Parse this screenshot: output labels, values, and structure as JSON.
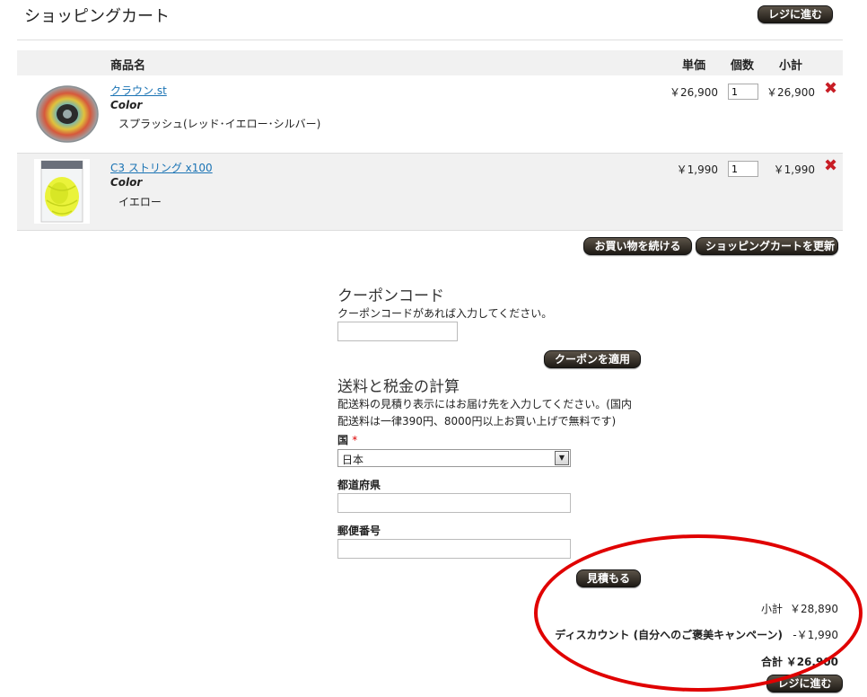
{
  "page": {
    "title": "ショッピングカート"
  },
  "buttons": {
    "checkout_top": "レジに進む",
    "continue_shopping": "お買い物を続ける",
    "update_cart": "ショッピングカートを更新",
    "apply_coupon": "クーポンを適用",
    "estimate": "見積もる",
    "checkout_bottom": "レジに進む"
  },
  "table": {
    "headers": {
      "product": "商品名",
      "unit_price": "単価",
      "qty": "個数",
      "subtotal": "小計"
    },
    "items": [
      {
        "name": "クラウン.st",
        "option_label": "Color",
        "option_value": "スプラッシュ(レッド･イエロー･シルバー)",
        "unit_price": "￥26,900",
        "qty": "1",
        "subtotal": "￥26,900"
      },
      {
        "name": "C3 ストリング x100",
        "option_label": "Color",
        "option_value": "イエロー",
        "unit_price": "￥1,990",
        "qty": "1",
        "subtotal": "￥1,990"
      }
    ]
  },
  "coupon": {
    "title": "クーポンコード",
    "description": "クーポンコードがあれば入力してください。",
    "value": ""
  },
  "shipping": {
    "title": "送料と税金の計算",
    "description_line1": "配送料の見積り表示にはお届け先を入力してください。(国内",
    "description_line2": "配送料は一律390円、8000円以上お買い上げで無料です)",
    "country_label": "国",
    "required_mark": "*",
    "country_value": "日本",
    "region_label": "都道府県",
    "region_value": "",
    "postcode_label": "郵便番号",
    "postcode_value": ""
  },
  "totals": {
    "subtotal_label": "小計",
    "subtotal_value": "￥28,890",
    "discount_label": "ディスカウント (自分へのご褒美キャンペーン)",
    "discount_value": "-￥1,990",
    "grand_label": "合計",
    "grand_value": "￥26,900"
  },
  "colors": {
    "annotation": "#e00000",
    "link": "#1a73b4",
    "remove": "#c81d25"
  }
}
